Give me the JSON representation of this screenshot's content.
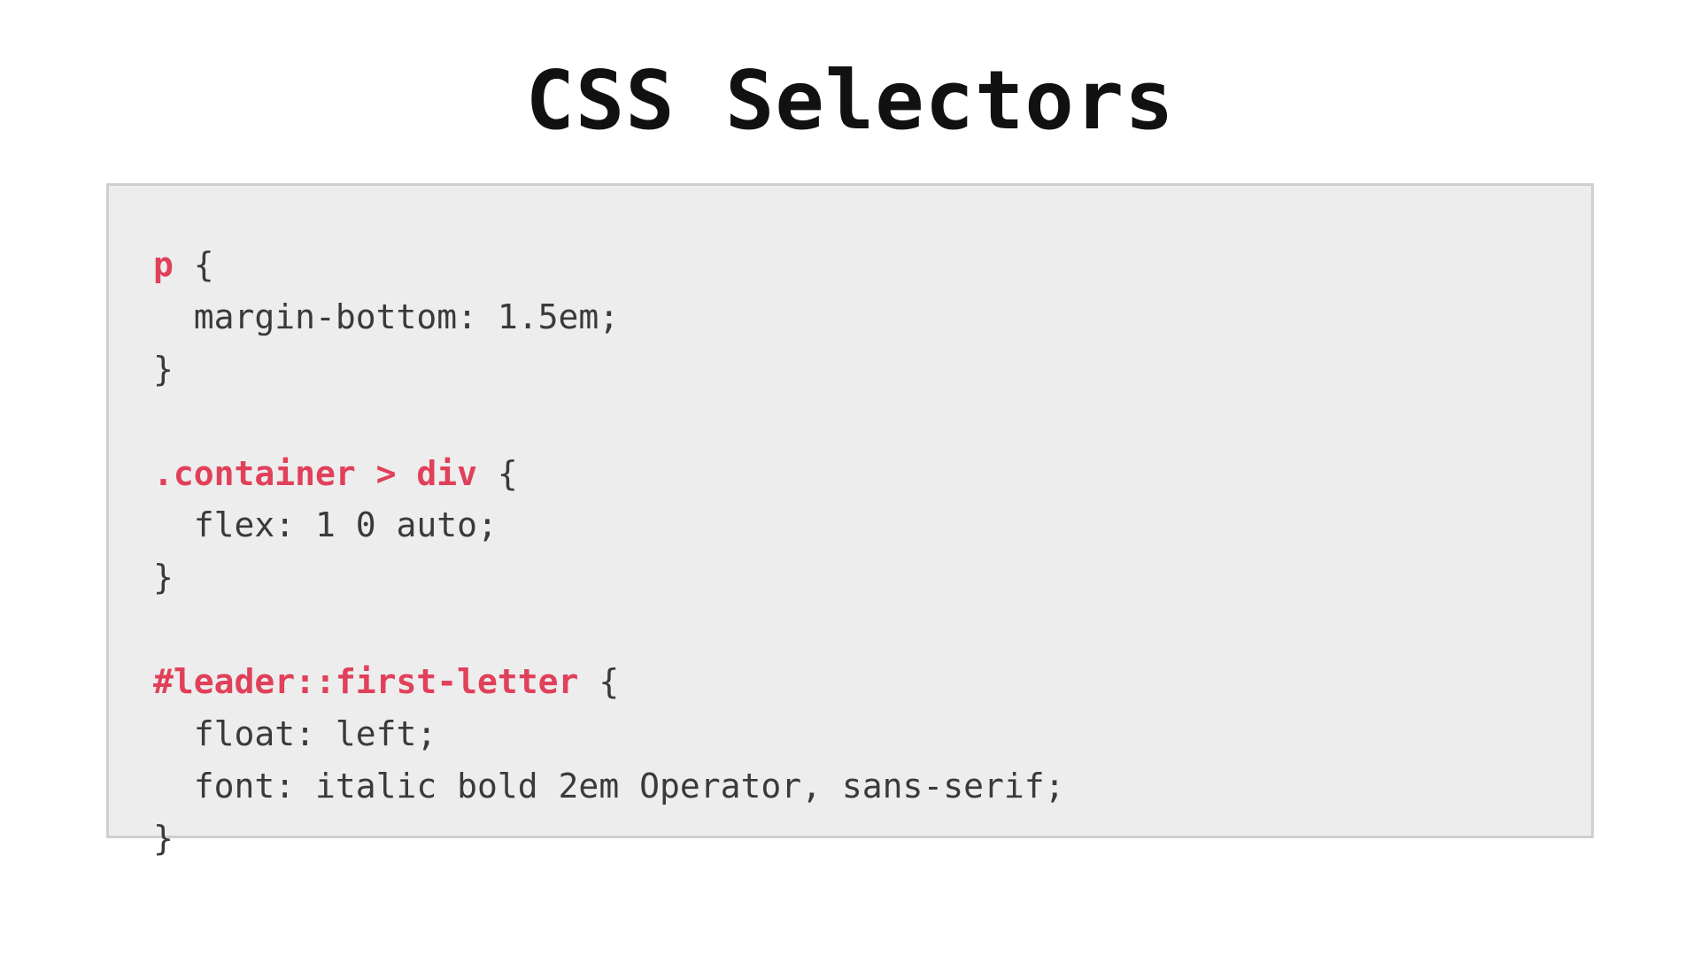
{
  "title": "CSS Selectors",
  "code": {
    "rule1": {
      "selector": "p",
      "open": " {",
      "line1": "  margin-bottom: 1.5em;",
      "close": "}"
    },
    "rule2": {
      "selector": ".container > div",
      "open": " {",
      "line1": "  flex: 1 0 auto;",
      "close": "}"
    },
    "rule3": {
      "selector": "#leader::first-letter",
      "open": " {",
      "line1": "  float: left;",
      "line2": "  font: italic bold 2em Operator, sans-serif;",
      "close": "}"
    }
  },
  "colors": {
    "selector": "#e1405a",
    "box_bg": "#ededed",
    "box_border": "#cfcfcf",
    "text": "#3a3a3a"
  }
}
